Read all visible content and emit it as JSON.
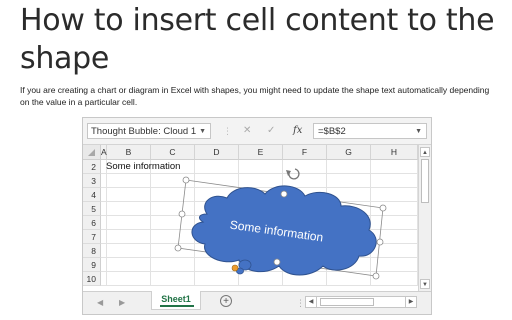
{
  "article": {
    "title": "How to insert cell content to the shape",
    "intro": "If you are creating a chart or diagram in Excel with shapes, you might need to update the shape text automatically depending on the value in a particular cell."
  },
  "excel": {
    "name_box": "Thought Bubble: Cloud 1",
    "formula": "=$B$2",
    "formula_buttons": {
      "cancel": "✕",
      "enter": "✓",
      "fx": "fx"
    },
    "columns": [
      "A",
      "B",
      "C",
      "D",
      "E",
      "F",
      "G",
      "H"
    ],
    "rows": [
      "2",
      "3",
      "4",
      "5",
      "6",
      "7",
      "8",
      "9",
      "10"
    ],
    "cell_b2": "Some information",
    "shape_text": "Some information",
    "shape_fill": "#4472c4",
    "sheet_tab": "Sheet1",
    "accent_color": "#217346"
  }
}
